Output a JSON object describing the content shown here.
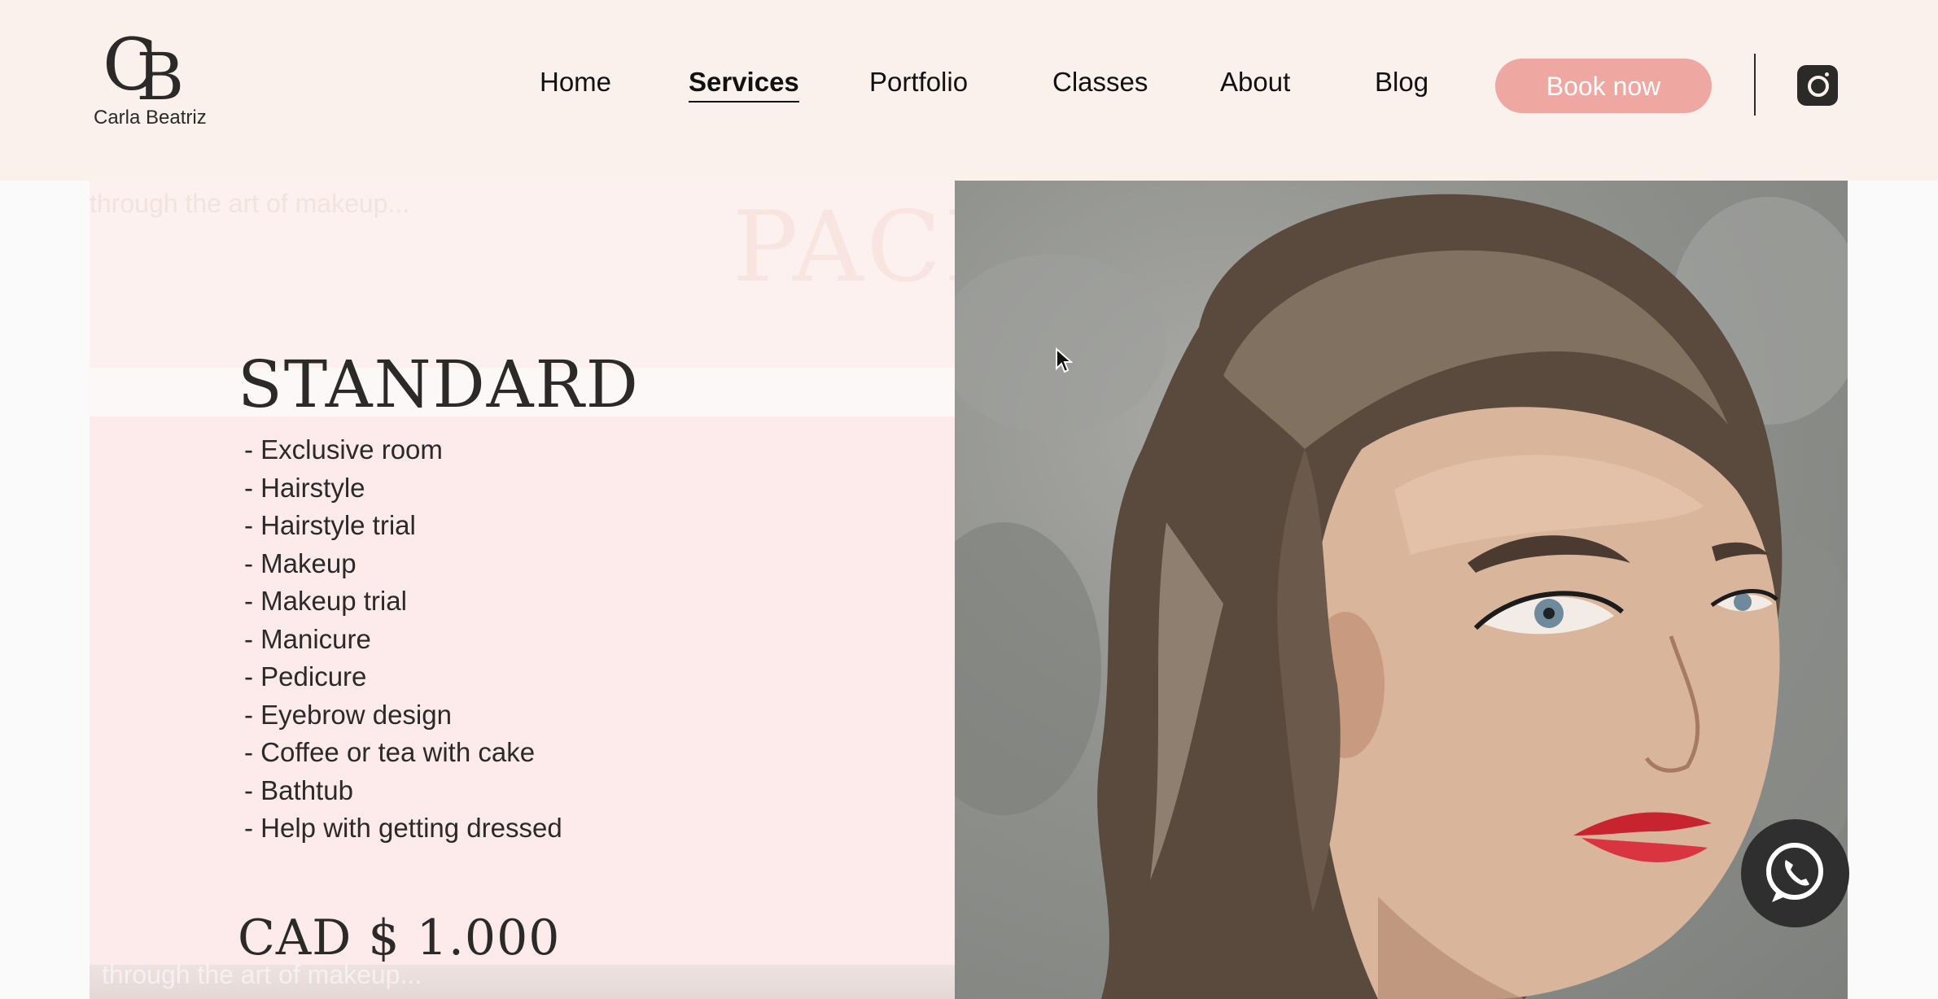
{
  "header": {
    "logo": {
      "monogram": "CB",
      "name": "Carla Beatriz"
    },
    "nav": [
      {
        "label": "Home",
        "active": false
      },
      {
        "label": "Services",
        "active": true
      },
      {
        "label": "Portfolio",
        "active": false
      },
      {
        "label": "Classes",
        "active": false
      },
      {
        "label": "About",
        "active": false
      },
      {
        "label": "Blog",
        "active": false
      }
    ],
    "book_label": "Book now",
    "social_icon": "instagram-icon"
  },
  "package": {
    "title": "STANDARD",
    "features": [
      "- Exclusive room",
      "- Hairstyle",
      "- Hairstyle trial",
      "- Makeup",
      "- Makeup trial",
      "- Manicure",
      "- Pedicure",
      "- Eyebrow design",
      "- Coffee or tea with cake",
      "- Bathtub",
      "- Help with getting dressed"
    ],
    "price": "CAD $ 1.000",
    "ghost_text": "through the art of makeup...",
    "ghost_heading": "PACK",
    "ghost_text_bottom": "through the art of makeup..."
  },
  "colors": {
    "header_bg": "#fbf1ec",
    "accent": "#efa8a1",
    "card_bg": "#fcebea",
    "text": "#2b2a28"
  },
  "floating": {
    "whatsapp_icon": "whatsapp-icon"
  }
}
